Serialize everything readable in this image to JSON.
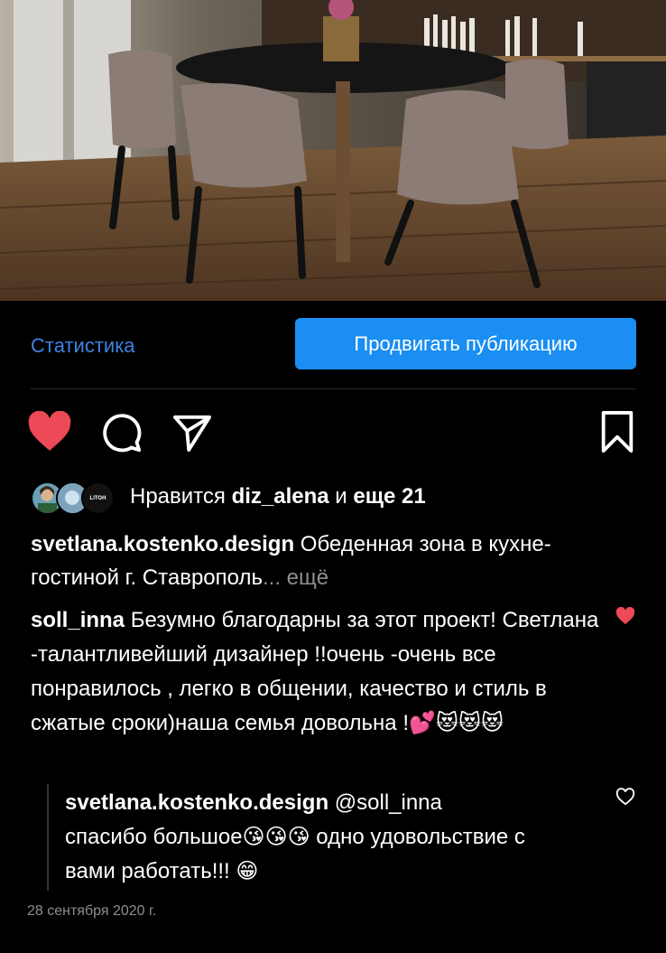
{
  "post_image": {
    "alt": "dining-room-photo"
  },
  "actions": {
    "statistics_label": "Статистика",
    "promote_label": "Продвигать публикацию"
  },
  "likes": {
    "prefix": "Нравится ",
    "user": "diz_alena",
    "middle": " и ",
    "rest": "еще 21",
    "avatar_badge_text": "LITOH"
  },
  "caption": {
    "author": "svetlana.kostenko.design",
    "text": " Обеденная зона в кухне-гостиной г. Ставрополь",
    "more": "... ещё"
  },
  "comment": {
    "author": "soll_inna",
    "text": " Безумно благодарны за этот проект! Светлана -талантливейший дизайнер !!очень -очень все понравилось , легко в общении, качество и стиль  в сжатые сроки)наша семья довольна !",
    "emojis": "💕😻😻😻"
  },
  "reply": {
    "author": "svetlana.kostenko.design",
    "mention": " @soll_inna",
    "text1": "спасибо большое",
    "emojis1": "😘😘😘",
    "text2": " одно удовольствие с вами работать!!! ",
    "emojis2": "😁"
  },
  "date": "28 сентября 2020 г.",
  "colors": {
    "accent_blue": "#1a8ef2",
    "link_blue": "#3d82e0",
    "like_red": "#ed4956",
    "background": "#000000",
    "muted": "#8e8e8e"
  },
  "icons": [
    "heart-filled-icon",
    "comment-icon",
    "share-icon",
    "bookmark-icon",
    "small-heart-filled-icon",
    "small-heart-outline-icon"
  ]
}
